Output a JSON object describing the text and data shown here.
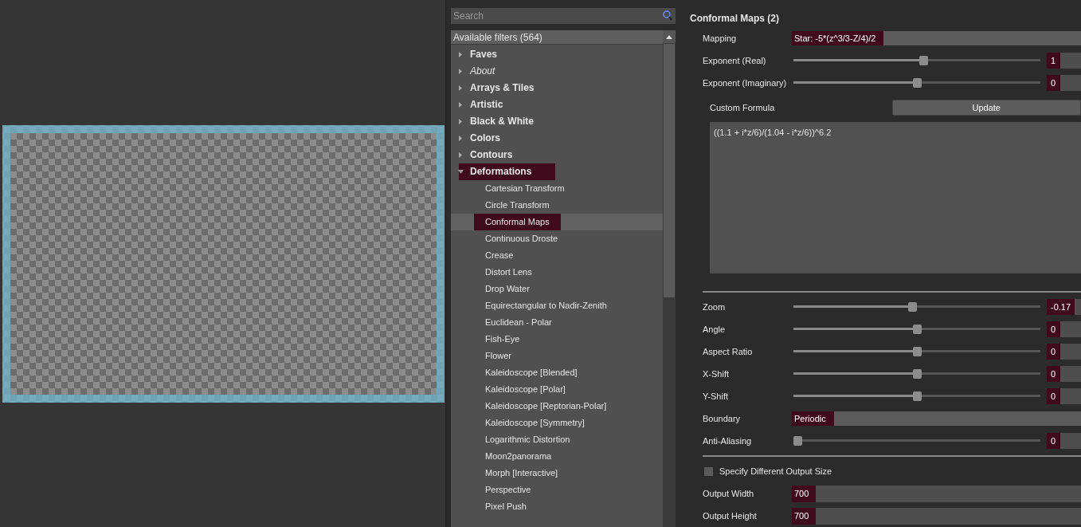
{
  "search": {
    "placeholder": "Search"
  },
  "filters": {
    "header": "Available filters (564)",
    "categories": [
      {
        "label": "Faves",
        "italic": false,
        "expanded": false,
        "selected": false
      },
      {
        "label": "About",
        "italic": true,
        "expanded": false,
        "selected": false
      },
      {
        "label": "Arrays & Tiles",
        "italic": false,
        "expanded": false,
        "selected": false
      },
      {
        "label": "Artistic",
        "italic": false,
        "expanded": false,
        "selected": false
      },
      {
        "label": "Black & White",
        "italic": false,
        "expanded": false,
        "selected": false
      },
      {
        "label": "Colors",
        "italic": false,
        "expanded": false,
        "selected": false
      },
      {
        "label": "Contours",
        "italic": false,
        "expanded": false,
        "selected": false
      },
      {
        "label": "Deformations",
        "italic": false,
        "expanded": true,
        "selected": true,
        "children": [
          {
            "label": "Cartesian Transform",
            "selected": false
          },
          {
            "label": "Circle Transform",
            "selected": false
          },
          {
            "label": "Conformal Maps",
            "selected": true
          },
          {
            "label": "Continuous Droste",
            "selected": false
          },
          {
            "label": "Crease",
            "selected": false
          },
          {
            "label": "Distort Lens",
            "selected": false
          },
          {
            "label": "Drop Water",
            "selected": false
          },
          {
            "label": "Equirectangular to Nadir-Zenith",
            "selected": false
          },
          {
            "label": "Euclidean - Polar",
            "selected": false
          },
          {
            "label": "Fish-Eye",
            "selected": false
          },
          {
            "label": "Flower",
            "selected": false
          },
          {
            "label": "Kaleidoscope [Blended]",
            "selected": false
          },
          {
            "label": "Kaleidoscope [Polar]",
            "selected": false
          },
          {
            "label": "Kaleidoscope [Reptorian-Polar]",
            "selected": false
          },
          {
            "label": "Kaleidoscope [Symmetry]",
            "selected": false
          },
          {
            "label": "Logarithmic Distortion",
            "selected": false
          },
          {
            "label": "Moon2panorama",
            "selected": false
          },
          {
            "label": "Morph [Interactive]",
            "selected": false
          },
          {
            "label": "Perspective",
            "selected": false
          },
          {
            "label": "Pixel Push",
            "selected": false
          }
        ]
      }
    ]
  },
  "settings": {
    "title": "Conformal Maps (2)",
    "controls": [
      {
        "kind": "dropdown",
        "label": "Mapping",
        "value": "Star: -5*(z^3/3-Z/4)/2"
      },
      {
        "kind": "slider",
        "label": "Exponent (Real)",
        "level": 0.53,
        "value": "1"
      },
      {
        "kind": "slider",
        "label": "Exponent (Imaginary)",
        "level": 0.5,
        "value": "0"
      },
      {
        "kind": "formula",
        "label": "Custom Formula",
        "button": "Update",
        "value": "((1.1 + i*z/6)/(1.04 - i*z/6))^6.2"
      },
      {
        "kind": "separator"
      },
      {
        "kind": "slider",
        "label": "Zoom",
        "level": 0.48,
        "value": "-0.17"
      },
      {
        "kind": "slider",
        "label": "Angle",
        "level": 0.5,
        "value": "0"
      },
      {
        "kind": "slider",
        "label": "Aspect Ratio",
        "level": 0.5,
        "value": "0"
      },
      {
        "kind": "slider",
        "label": "X-Shift",
        "level": 0.5,
        "value": "0"
      },
      {
        "kind": "slider",
        "label": "Y-Shift",
        "level": 0.5,
        "value": "0"
      },
      {
        "kind": "dropdown",
        "label": "Boundary",
        "value": "Periodic"
      },
      {
        "kind": "slider",
        "label": "Anti-Aliasing",
        "level": 0,
        "value": "0"
      },
      {
        "kind": "separator"
      },
      {
        "kind": "checkbox",
        "label": "Specify Different Output Size",
        "checked": false
      },
      {
        "kind": "number",
        "label": "Output Width",
        "value": "700"
      },
      {
        "kind": "number",
        "label": "Output Height",
        "value": "700"
      }
    ]
  }
}
